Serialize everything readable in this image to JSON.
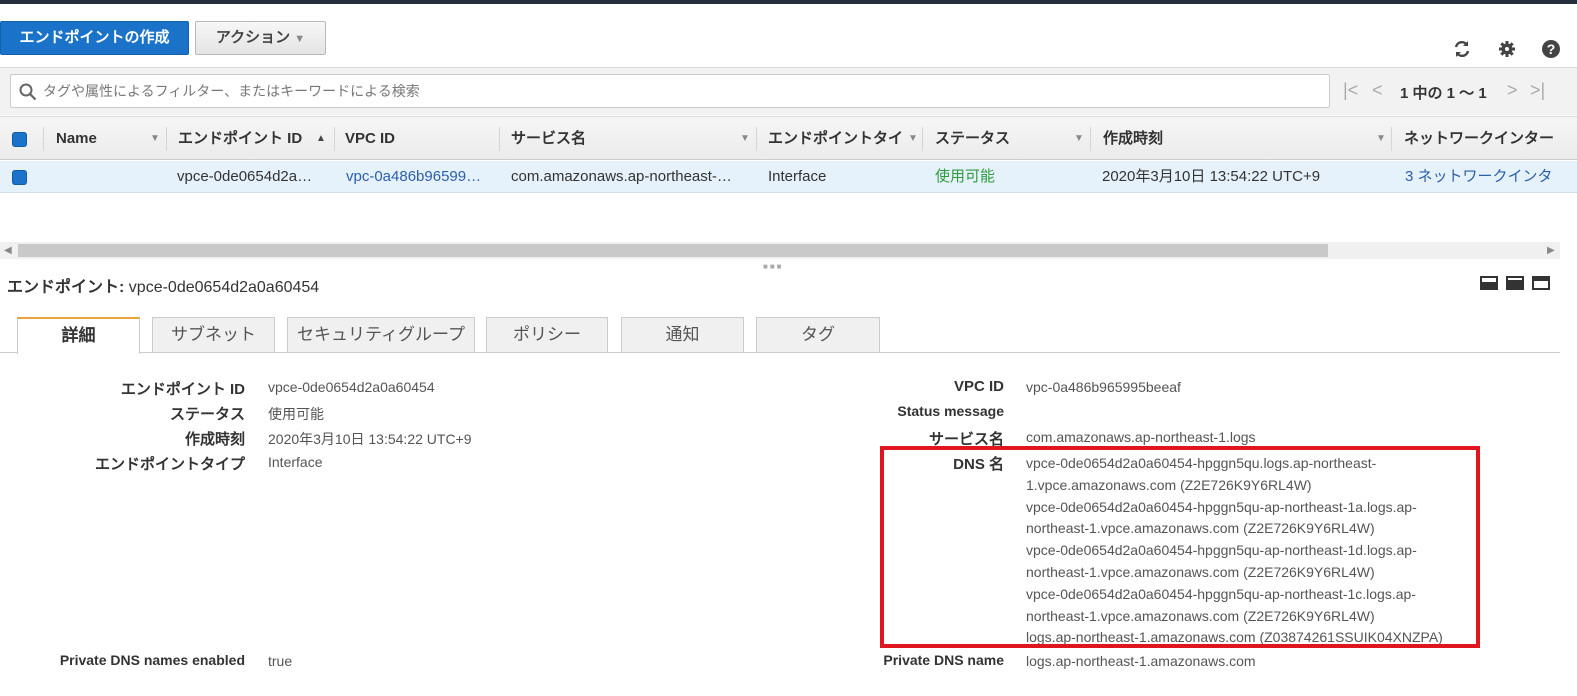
{
  "toolbar": {
    "create_label": "エンドポイントの作成",
    "action_label": "アクション"
  },
  "search": {
    "placeholder": "タグや属性によるフィルター、またはキーワードによる検索"
  },
  "pagination": {
    "text": "1 中の 1 ～ 1"
  },
  "table": {
    "columns": [
      "Name",
      "エンドポイント ID",
      "VPC ID",
      "サービス名",
      "エンドポイントタイ",
      "ステータス",
      "作成時刻",
      "ネットワークインター"
    ],
    "rows": [
      {
        "name": "",
        "endpoint_id": "vpce-0de0654d2a…",
        "vpc_id": "vpc-0a486b96599…",
        "service": "com.amazonaws.ap-northeast-…",
        "type": "Interface",
        "status": "使用可能",
        "created": "2020年3月10日 13:54:22 UTC+9",
        "network": "3 ネットワークインタ"
      }
    ]
  },
  "detail": {
    "title_label": "エンドポイント:",
    "title_value": "vpce-0de0654d2a0a60454",
    "tabs": [
      "詳細",
      "サブネット",
      "セキュリティグループ",
      "ポリシー",
      "通知",
      "タグ"
    ],
    "left": [
      {
        "label": "エンドポイント ID",
        "value": "vpce-0de0654d2a0a60454"
      },
      {
        "label": "ステータス",
        "value": "使用可能"
      },
      {
        "label": "作成時刻",
        "value": "2020年3月10日 13:54:22 UTC+9"
      },
      {
        "label": "エンドポイントタイプ",
        "value": "Interface"
      }
    ],
    "right": [
      {
        "label": "VPC ID",
        "value": "vpc-0a486b965995beeaf"
      },
      {
        "label": "Status message",
        "value": ""
      },
      {
        "label": "サービス名",
        "value": "com.amazonaws.ap-northeast-1.logs"
      }
    ],
    "dns_label": "DNS 名",
    "dns_lines": [
      "vpce-0de0654d2a0a60454-hpggn5qu.logs.ap-northeast-",
      "1.vpce.amazonaws.com (Z2E726K9Y6RL4W)",
      "vpce-0de0654d2a0a60454-hpggn5qu-ap-northeast-1a.logs.ap-",
      "northeast-1.vpce.amazonaws.com (Z2E726K9Y6RL4W)",
      "vpce-0de0654d2a0a60454-hpggn5qu-ap-northeast-1d.logs.ap-",
      "northeast-1.vpce.amazonaws.com (Z2E726K9Y6RL4W)",
      "vpce-0de0654d2a0a60454-hpggn5qu-ap-northeast-1c.logs.ap-",
      "northeast-1.vpce.amazonaws.com (Z2E726K9Y6RL4W)",
      "logs.ap-northeast-1.amazonaws.com (Z03874261SSUIK04XNZPA)"
    ],
    "private_dns_enabled_label": "Private DNS names enabled",
    "private_dns_enabled_value": "true",
    "private_dns_name_label": "Private DNS name",
    "private_dns_name_value": "logs.ap-northeast-1.amazonaws.com"
  },
  "colors": {
    "primary": "#1a73c9",
    "link": "#2c5fa9",
    "status_ok": "#2e9b3c",
    "highlight_box": "#e0161e"
  }
}
